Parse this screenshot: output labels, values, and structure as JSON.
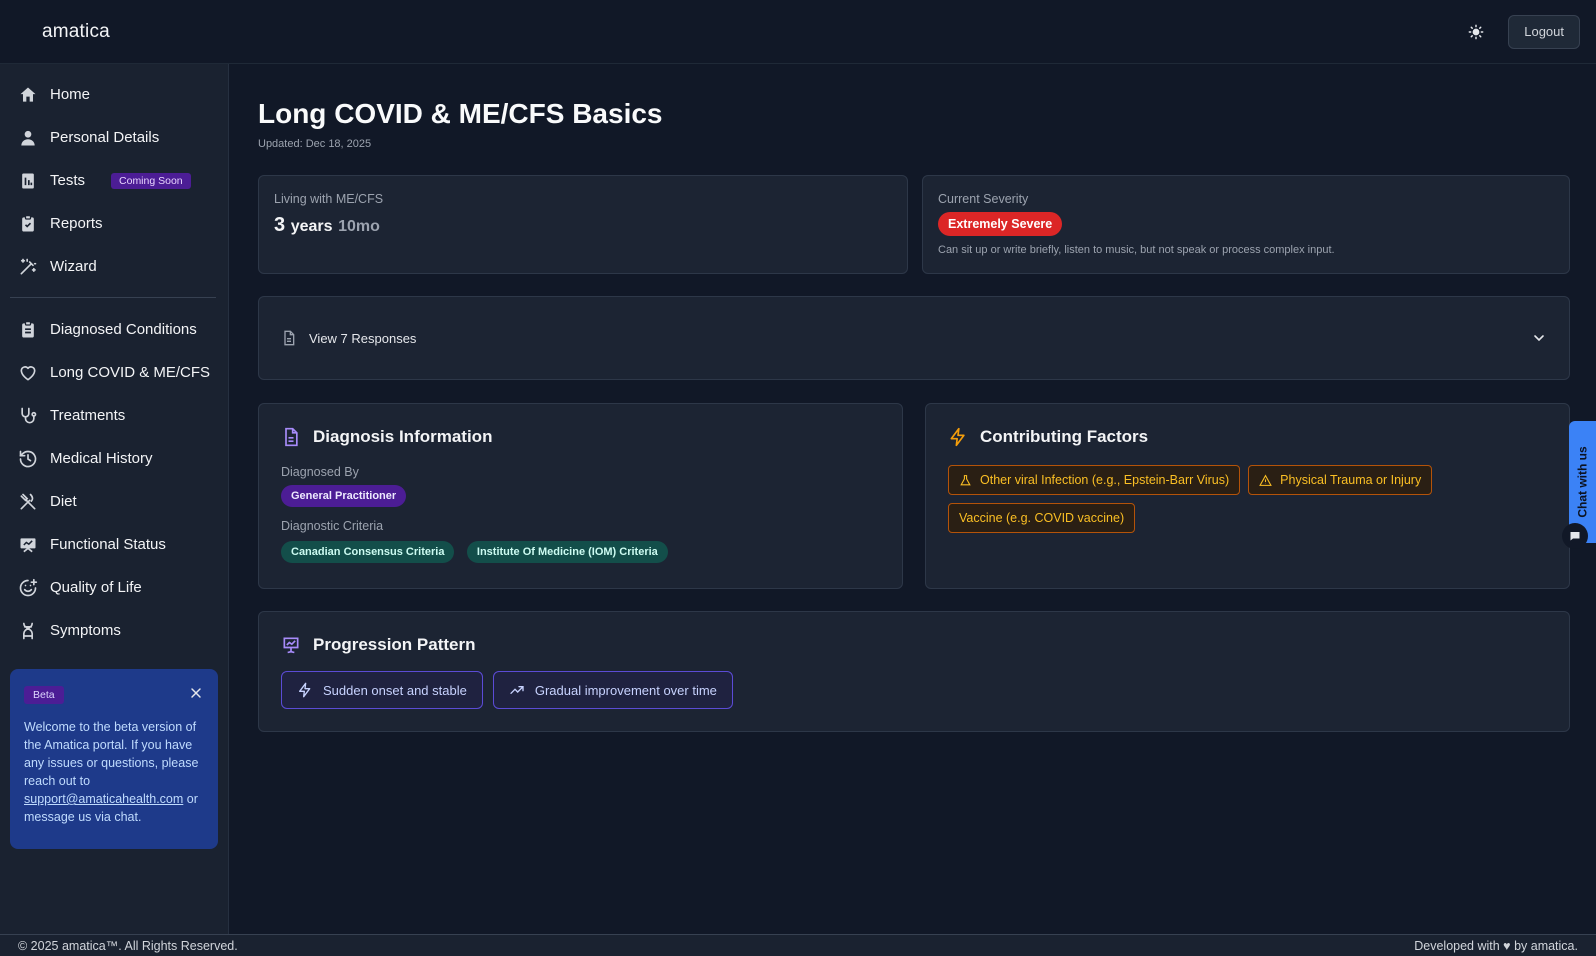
{
  "header": {
    "brand": "amatica",
    "logout_label": "Logout",
    "theme_icon": "sun-icon"
  },
  "sidebar": {
    "items": [
      {
        "label": "Home",
        "icon": "home-icon"
      },
      {
        "label": "Personal Details",
        "icon": "user-icon"
      },
      {
        "label": "Tests",
        "icon": "test-icon",
        "badge": "Coming Soon"
      },
      {
        "label": "Reports",
        "icon": "clipboard-check-icon"
      },
      {
        "label": "Wizard",
        "icon": "wand-icon"
      },
      {
        "label": "Diagnosed Conditions",
        "icon": "clipboard-list-icon"
      },
      {
        "label": "Long COVID & ME/CFS",
        "icon": "heart-icon"
      },
      {
        "label": "Treatments",
        "icon": "stethoscope-icon"
      },
      {
        "label": "Medical History",
        "icon": "history-icon"
      },
      {
        "label": "Diet",
        "icon": "utensils-icon"
      },
      {
        "label": "Functional Status",
        "icon": "presentation-icon"
      },
      {
        "label": "Quality of Life",
        "icon": "smile-plus-icon"
      },
      {
        "label": "Symptoms",
        "icon": "dna-icon"
      }
    ],
    "beta": {
      "tag": "Beta",
      "text_before": "Welcome to the beta version of the Amatica portal. If you have any issues or questions, please reach out to",
      "email": "support@amaticahealth.com",
      "text_after": "or message us via chat."
    }
  },
  "main": {
    "title": "Long COVID & ME/CFS Basics",
    "updated": "Updated: Dec 18, 2025",
    "living": {
      "label": "Living with ME/CFS",
      "years_num": "3",
      "years_unit": "years",
      "months": "10mo"
    },
    "severity": {
      "label": "Current Severity",
      "value": "Extremely Severe",
      "description": "Can sit up or write briefly, listen to music, but not speak or process complex input."
    },
    "responses": {
      "label": "View 7 Responses"
    },
    "diagnosis": {
      "title": "Diagnosis Information",
      "diagnosed_by_label": "Diagnosed By",
      "diagnosed_by": "General Practitioner",
      "criteria_label": "Diagnostic Criteria",
      "criteria": [
        "Canadian Consensus Criteria",
        "Institute Of Medicine (IOM) Criteria"
      ]
    },
    "factors": {
      "title": "Contributing Factors",
      "items": [
        {
          "label": "Other viral Infection (e.g., Epstein-Barr Virus)",
          "icon": "flask-icon"
        },
        {
          "label": "Physical Trauma or Injury",
          "icon": "warning-icon"
        },
        {
          "label": "Vaccine (e.g. COVID vaccine)",
          "icon": ""
        }
      ]
    },
    "progression": {
      "title": "Progression Pattern",
      "items": [
        {
          "label": "Sudden onset and stable",
          "icon": "zap-icon"
        },
        {
          "label": "Gradual improvement over time",
          "icon": "trending-up-icon"
        }
      ]
    }
  },
  "chat": {
    "label": "Chat with us"
  },
  "footer": {
    "left": "© 2025 amatica™. All Rights Reserved.",
    "right": "Developed with ♥ by amatica."
  }
}
